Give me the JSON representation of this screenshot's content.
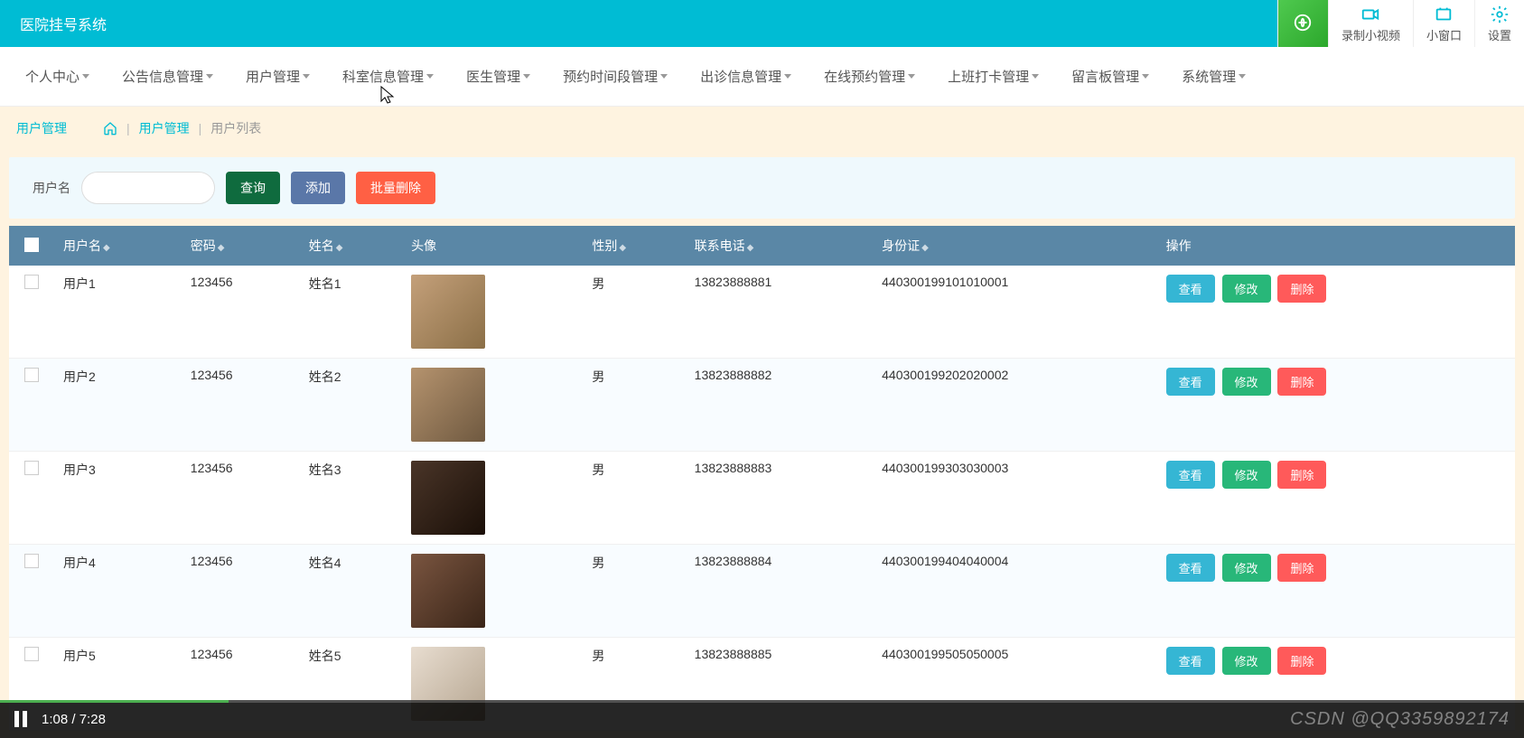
{
  "header": {
    "title": "医院挂号系统"
  },
  "tools": {
    "record": "录制小视频",
    "window": "小窗口",
    "settings": "设置"
  },
  "nav": [
    "个人中心",
    "公告信息管理",
    "用户管理",
    "科室信息管理",
    "医生管理",
    "预约时间段管理",
    "出诊信息管理",
    "在线预约管理",
    "上班打卡管理",
    "留言板管理",
    "系统管理"
  ],
  "breadcrumb": {
    "current": "用户管理",
    "link": "用户管理",
    "page": "用户列表"
  },
  "search": {
    "label": "用户名",
    "btn_search": "查询",
    "btn_add": "添加",
    "btn_batch_del": "批量删除"
  },
  "table": {
    "headers": {
      "username": "用户名",
      "password": "密码",
      "name": "姓名",
      "avatar": "头像",
      "gender": "性别",
      "phone": "联系电话",
      "idcard": "身份证",
      "actions": "操作"
    },
    "actions": {
      "view": "查看",
      "edit": "修改",
      "del": "删除"
    },
    "rows": [
      {
        "username": "用户1",
        "password": "123456",
        "name": "姓名1",
        "gender": "男",
        "phone": "13823888881",
        "idcard": "440300199101010001"
      },
      {
        "username": "用户2",
        "password": "123456",
        "name": "姓名2",
        "gender": "男",
        "phone": "13823888882",
        "idcard": "440300199202020002"
      },
      {
        "username": "用户3",
        "password": "123456",
        "name": "姓名3",
        "gender": "男",
        "phone": "13823888883",
        "idcard": "440300199303030003"
      },
      {
        "username": "用户4",
        "password": "123456",
        "name": "姓名4",
        "gender": "男",
        "phone": "13823888884",
        "idcard": "440300199404040004"
      },
      {
        "username": "用户5",
        "password": "123456",
        "name": "姓名5",
        "gender": "男",
        "phone": "13823888885",
        "idcard": "440300199505050005"
      }
    ]
  },
  "player": {
    "current": "1:08",
    "total": "7:28",
    "watermark": "CSDN @QQ3359892174"
  }
}
